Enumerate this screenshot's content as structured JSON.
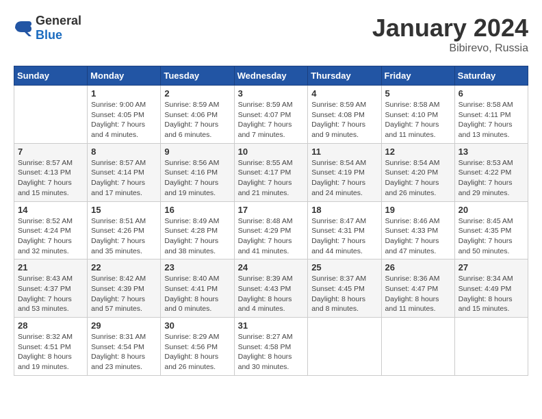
{
  "header": {
    "logo_general": "General",
    "logo_blue": "Blue",
    "month_year": "January 2024",
    "location": "Bibirevo, Russia"
  },
  "days_of_week": [
    "Sunday",
    "Monday",
    "Tuesday",
    "Wednesday",
    "Thursday",
    "Friday",
    "Saturday"
  ],
  "weeks": [
    [
      {
        "day": "",
        "info": ""
      },
      {
        "day": "1",
        "info": "Sunrise: 9:00 AM\nSunset: 4:05 PM\nDaylight: 7 hours\nand 4 minutes."
      },
      {
        "day": "2",
        "info": "Sunrise: 8:59 AM\nSunset: 4:06 PM\nDaylight: 7 hours\nand 6 minutes."
      },
      {
        "day": "3",
        "info": "Sunrise: 8:59 AM\nSunset: 4:07 PM\nDaylight: 7 hours\nand 7 minutes."
      },
      {
        "day": "4",
        "info": "Sunrise: 8:59 AM\nSunset: 4:08 PM\nDaylight: 7 hours\nand 9 minutes."
      },
      {
        "day": "5",
        "info": "Sunrise: 8:58 AM\nSunset: 4:10 PM\nDaylight: 7 hours\nand 11 minutes."
      },
      {
        "day": "6",
        "info": "Sunrise: 8:58 AM\nSunset: 4:11 PM\nDaylight: 7 hours\nand 13 minutes."
      }
    ],
    [
      {
        "day": "7",
        "info": "Sunrise: 8:57 AM\nSunset: 4:13 PM\nDaylight: 7 hours\nand 15 minutes."
      },
      {
        "day": "8",
        "info": "Sunrise: 8:57 AM\nSunset: 4:14 PM\nDaylight: 7 hours\nand 17 minutes."
      },
      {
        "day": "9",
        "info": "Sunrise: 8:56 AM\nSunset: 4:16 PM\nDaylight: 7 hours\nand 19 minutes."
      },
      {
        "day": "10",
        "info": "Sunrise: 8:55 AM\nSunset: 4:17 PM\nDaylight: 7 hours\nand 21 minutes."
      },
      {
        "day": "11",
        "info": "Sunrise: 8:54 AM\nSunset: 4:19 PM\nDaylight: 7 hours\nand 24 minutes."
      },
      {
        "day": "12",
        "info": "Sunrise: 8:54 AM\nSunset: 4:20 PM\nDaylight: 7 hours\nand 26 minutes."
      },
      {
        "day": "13",
        "info": "Sunrise: 8:53 AM\nSunset: 4:22 PM\nDaylight: 7 hours\nand 29 minutes."
      }
    ],
    [
      {
        "day": "14",
        "info": "Sunrise: 8:52 AM\nSunset: 4:24 PM\nDaylight: 7 hours\nand 32 minutes."
      },
      {
        "day": "15",
        "info": "Sunrise: 8:51 AM\nSunset: 4:26 PM\nDaylight: 7 hours\nand 35 minutes."
      },
      {
        "day": "16",
        "info": "Sunrise: 8:49 AM\nSunset: 4:28 PM\nDaylight: 7 hours\nand 38 minutes."
      },
      {
        "day": "17",
        "info": "Sunrise: 8:48 AM\nSunset: 4:29 PM\nDaylight: 7 hours\nand 41 minutes."
      },
      {
        "day": "18",
        "info": "Sunrise: 8:47 AM\nSunset: 4:31 PM\nDaylight: 7 hours\nand 44 minutes."
      },
      {
        "day": "19",
        "info": "Sunrise: 8:46 AM\nSunset: 4:33 PM\nDaylight: 7 hours\nand 47 minutes."
      },
      {
        "day": "20",
        "info": "Sunrise: 8:45 AM\nSunset: 4:35 PM\nDaylight: 7 hours\nand 50 minutes."
      }
    ],
    [
      {
        "day": "21",
        "info": "Sunrise: 8:43 AM\nSunset: 4:37 PM\nDaylight: 7 hours\nand 53 minutes."
      },
      {
        "day": "22",
        "info": "Sunrise: 8:42 AM\nSunset: 4:39 PM\nDaylight: 7 hours\nand 57 minutes."
      },
      {
        "day": "23",
        "info": "Sunrise: 8:40 AM\nSunset: 4:41 PM\nDaylight: 8 hours\nand 0 minutes."
      },
      {
        "day": "24",
        "info": "Sunrise: 8:39 AM\nSunset: 4:43 PM\nDaylight: 8 hours\nand 4 minutes."
      },
      {
        "day": "25",
        "info": "Sunrise: 8:37 AM\nSunset: 4:45 PM\nDaylight: 8 hours\nand 8 minutes."
      },
      {
        "day": "26",
        "info": "Sunrise: 8:36 AM\nSunset: 4:47 PM\nDaylight: 8 hours\nand 11 minutes."
      },
      {
        "day": "27",
        "info": "Sunrise: 8:34 AM\nSunset: 4:49 PM\nDaylight: 8 hours\nand 15 minutes."
      }
    ],
    [
      {
        "day": "28",
        "info": "Sunrise: 8:32 AM\nSunset: 4:51 PM\nDaylight: 8 hours\nand 19 minutes."
      },
      {
        "day": "29",
        "info": "Sunrise: 8:31 AM\nSunset: 4:54 PM\nDaylight: 8 hours\nand 23 minutes."
      },
      {
        "day": "30",
        "info": "Sunrise: 8:29 AM\nSunset: 4:56 PM\nDaylight: 8 hours\nand 26 minutes."
      },
      {
        "day": "31",
        "info": "Sunrise: 8:27 AM\nSunset: 4:58 PM\nDaylight: 8 hours\nand 30 minutes."
      },
      {
        "day": "",
        "info": ""
      },
      {
        "day": "",
        "info": ""
      },
      {
        "day": "",
        "info": ""
      }
    ]
  ]
}
